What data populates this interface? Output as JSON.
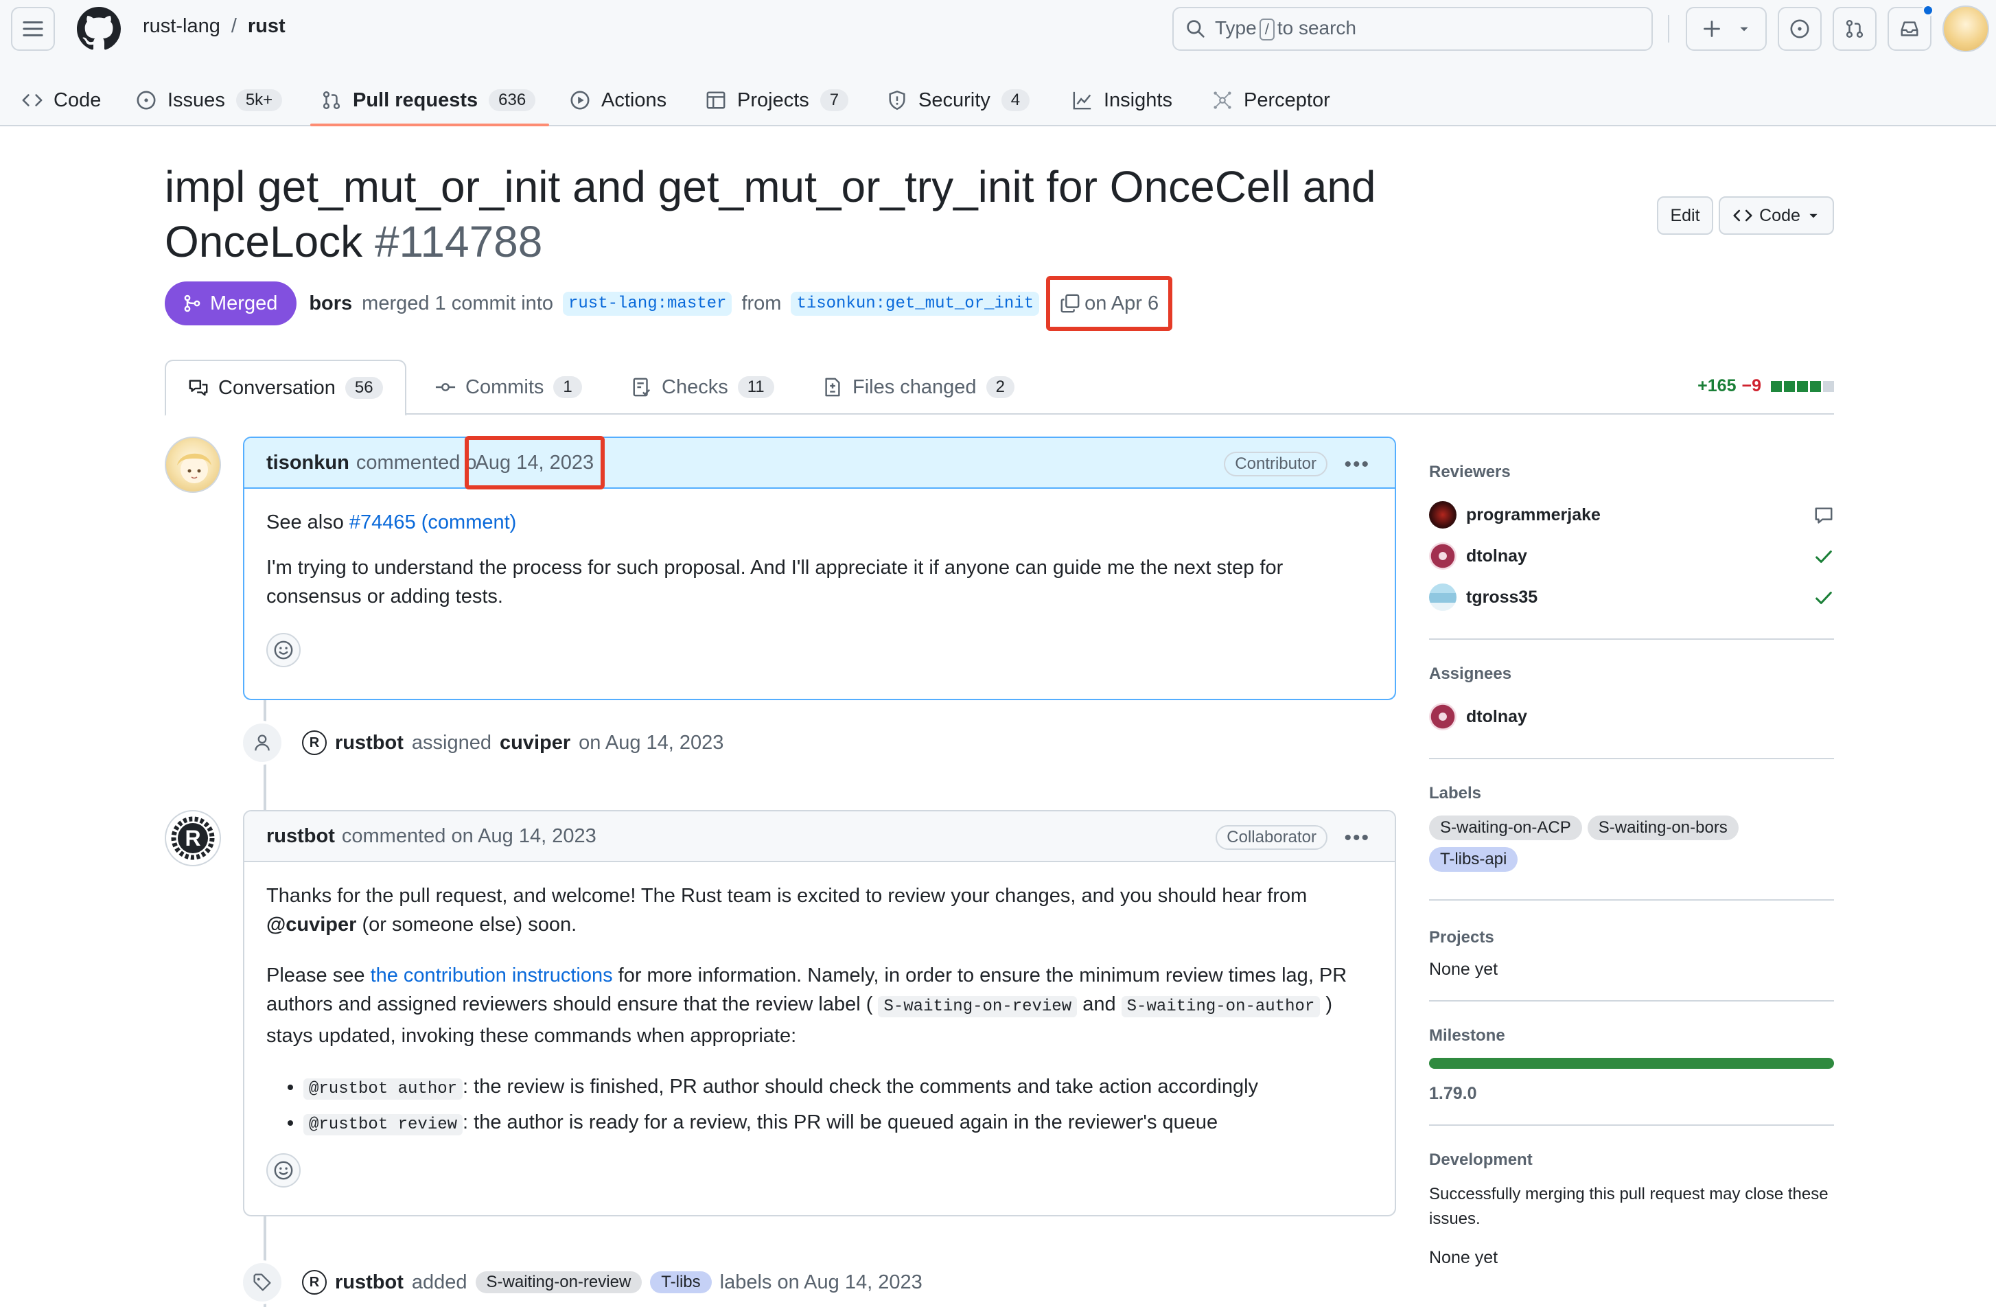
{
  "header": {
    "owner": "rust-lang",
    "separator": "/",
    "repo": "rust",
    "search_pre": "Type",
    "search_key": "/",
    "search_post": "to search"
  },
  "repo_nav": [
    {
      "label": "Code",
      "count": "",
      "icon": "code-icon"
    },
    {
      "label": "Issues",
      "count": "5k+",
      "icon": "issue-opened-icon"
    },
    {
      "label": "Pull requests",
      "count": "636",
      "icon": "git-pull-request-icon"
    },
    {
      "label": "Actions",
      "count": "",
      "icon": "play-icon"
    },
    {
      "label": "Projects",
      "count": "7",
      "icon": "table-icon"
    },
    {
      "label": "Security",
      "count": "4",
      "icon": "shield-icon"
    },
    {
      "label": "Insights",
      "count": "",
      "icon": "graph-icon"
    },
    {
      "label": "Perceptor",
      "count": "",
      "icon": "perceptor-icon"
    }
  ],
  "pr": {
    "title": "impl get_mut_or_init and get_mut_or_try_init for OnceCell and OnceLock",
    "number": "#114788",
    "state": "Merged",
    "merger": "bors",
    "merged_text": "merged 1 commit into",
    "base_branch": "rust-lang:master",
    "from_text": "from",
    "head_branch": "tisonkun:get_mut_or_init",
    "merged_date": "on Apr 6",
    "edit_label": "Edit",
    "code_label": "Code"
  },
  "tabs": [
    {
      "label": "Conversation",
      "count": "56"
    },
    {
      "label": "Commits",
      "count": "1"
    },
    {
      "label": "Checks",
      "count": "11"
    },
    {
      "label": "Files changed",
      "count": "2"
    }
  ],
  "diffstat": {
    "additions": "+165",
    "deletions": "−9"
  },
  "comments": [
    {
      "author": "tisonkun",
      "action": "commented o",
      "date": "Aug 14, 2023",
      "role": "Contributor",
      "see_also_prefix": "See also",
      "see_also_link": "#74465 (comment)",
      "body": "I'm trying to understand the process for such proposal. And I'll appreciate it if anyone can guide me the next step for consensus or adding tests."
    },
    {
      "author": "rustbot",
      "action": "commented on Aug 14, 2023",
      "role": "Collaborator",
      "p1": "Thanks for the pull request, and welcome! The Rust team is excited to review your changes, and you should hear from",
      "p1_mention": "@cuviper",
      "p1_tail": "(or someone else) soon.",
      "p2_a": "Please see",
      "p2_link": "the contribution instructions",
      "p2_b": "for more information. Namely, in order to ensure the minimum review times lag, PR authors and assigned reviewers should ensure that the review label (",
      "p2_code1": "S-waiting-on-review",
      "p2_and": "and",
      "p2_code2": "S-waiting-on-author",
      "p2_c": ") stays updated, invoking these commands when appropriate:",
      "bullets": [
        {
          "code": "@rustbot author",
          "text": ": the review is finished, PR author should check the comments and take action accordingly"
        },
        {
          "code": "@rustbot review",
          "text": ": the author is ready for a review, this PR will be queued again in the reviewer's queue"
        }
      ]
    }
  ],
  "events": [
    {
      "actor": "rustbot",
      "verb": "assigned",
      "target": "cuviper",
      "date": "on Aug 14, 2023"
    },
    {
      "actor": "rustbot",
      "verb": "added",
      "labels": [
        "S-waiting-on-review",
        "T-libs"
      ],
      "tail": "labels on Aug 14, 2023"
    }
  ],
  "sidebar": {
    "reviewers_title": "Reviewers",
    "reviewers": [
      {
        "name": "programmerjake",
        "status": "comment-icon"
      },
      {
        "name": "dtolnay",
        "status": "check-icon"
      },
      {
        "name": "tgross35",
        "status": "check-icon"
      }
    ],
    "assignees_title": "Assignees",
    "assignee": "dtolnay",
    "labels_title": "Labels",
    "labels": [
      "S-waiting-on-ACP",
      "S-waiting-on-bors",
      "T-libs-api"
    ],
    "projects_title": "Projects",
    "projects_value": "None yet",
    "milestone_title": "Milestone",
    "milestone": "1.79.0",
    "development_title": "Development",
    "development_text": "Successfully merging this pull request may close these issues.",
    "development_value": "None yet"
  },
  "colors": {
    "merged": "#8250df",
    "accent": "#0969da",
    "highlight_box": "#e53b27",
    "label_gray": "#dfe1e4",
    "label_blue": "#c5d1f6"
  }
}
